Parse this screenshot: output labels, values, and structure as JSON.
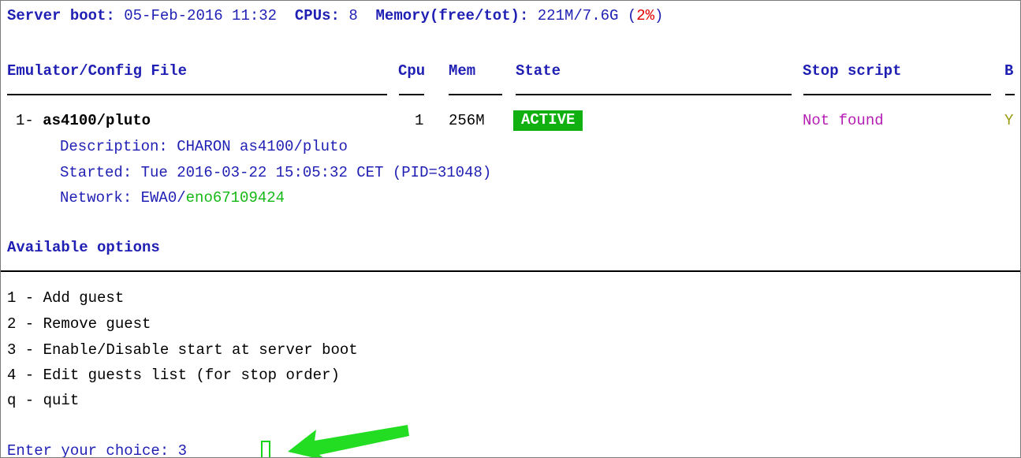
{
  "header": {
    "boot_label": "Server boot:",
    "boot_value": "05-Feb-2016 11:32",
    "cpus_label": "CPUs:",
    "cpus_value": "8",
    "memory_label": "Memory(free/tot):",
    "memory_value": "221M/7.6G",
    "memory_open": "(",
    "memory_pct": "2%",
    "memory_close": ")"
  },
  "columns": {
    "config": "Emulator/Config File",
    "cpu": "Cpu",
    "mem": "Mem",
    "state": "State",
    "stop_script": "Stop script",
    "boot": "B"
  },
  "guests": [
    {
      "index": "1-",
      "name": "as4100/pluto",
      "cpu": "1",
      "mem": "256M",
      "state": "ACTIVE",
      "stop_script": "Not found",
      "boot": "Y",
      "description": "Description: CHARON as4100/pluto",
      "started": "Started: Tue 2016-03-22 15:05:32 CET (PID=31048)",
      "network_label": "Network: EWA0/",
      "network_iface": "eno67109424"
    }
  ],
  "options_title": "Available options",
  "options": [
    "1 - Add guest",
    "2 - Remove guest",
    "3 - Enable/Disable start at server boot",
    "4 - Edit guests list (for stop order)",
    "q - quit"
  ],
  "prompt": {
    "label": "Enter your choice:",
    "value": "3"
  },
  "colors": {
    "accent_blue": "#1f1fb4",
    "active_green": "#10b010",
    "pointer_arrow": "#22dd22",
    "warning_magenta": "#b41eb4"
  }
}
